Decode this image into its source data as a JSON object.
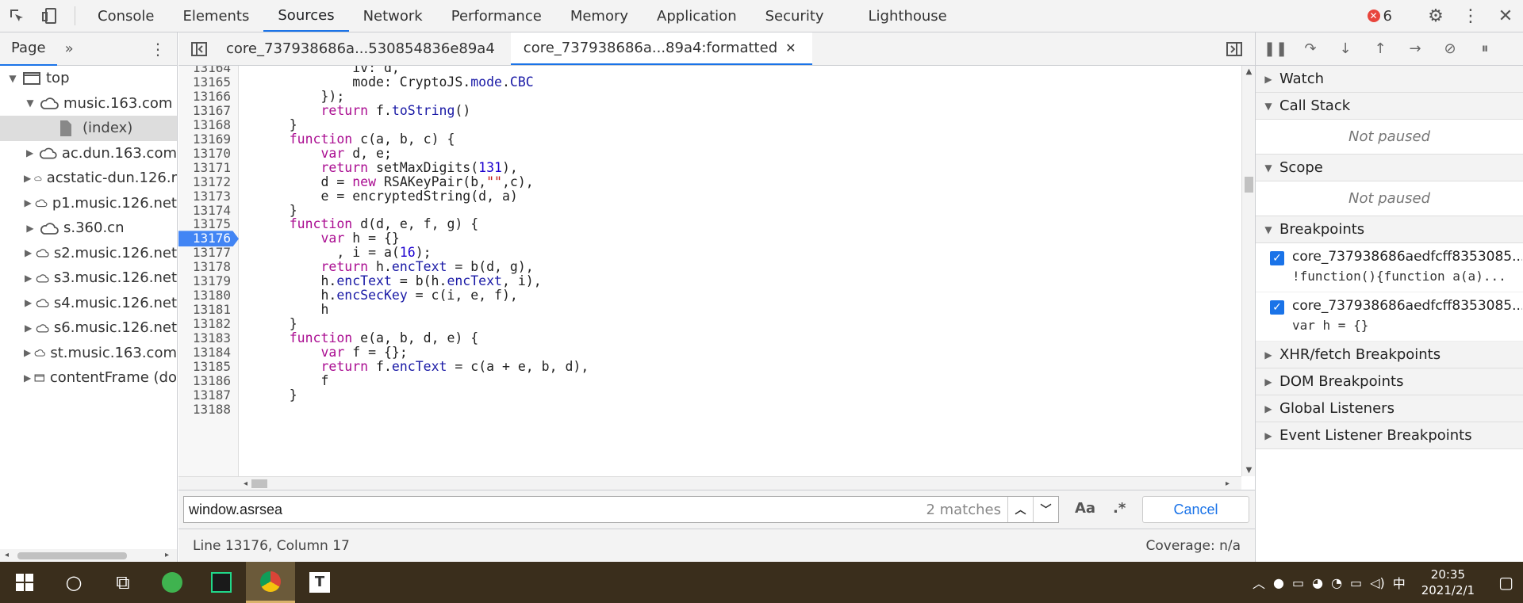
{
  "devtools_tabs": [
    "Console",
    "Elements",
    "Sources",
    "Network",
    "Performance",
    "Memory",
    "Application",
    "Security",
    "Lighthouse"
  ],
  "active_tab": "Sources",
  "error_count": "6",
  "navigator": {
    "tab_label": "Page",
    "tree": [
      {
        "label": "top",
        "type": "frame",
        "depth": 0,
        "expanded": true
      },
      {
        "label": "music.163.com",
        "type": "cloud",
        "depth": 1,
        "expanded": true
      },
      {
        "label": "(index)",
        "type": "file",
        "depth": 2,
        "selected": true
      },
      {
        "label": "ac.dun.163.com",
        "type": "cloud",
        "depth": 1
      },
      {
        "label": "acstatic-dun.126.r",
        "type": "cloud",
        "depth": 1
      },
      {
        "label": "p1.music.126.net",
        "type": "cloud",
        "depth": 1
      },
      {
        "label": "s.360.cn",
        "type": "cloud",
        "depth": 1
      },
      {
        "label": "s2.music.126.net",
        "type": "cloud",
        "depth": 1
      },
      {
        "label": "s3.music.126.net",
        "type": "cloud",
        "depth": 1
      },
      {
        "label": "s4.music.126.net",
        "type": "cloud",
        "depth": 1
      },
      {
        "label": "s6.music.126.net",
        "type": "cloud",
        "depth": 1
      },
      {
        "label": "st.music.163.com",
        "type": "cloud",
        "depth": 1
      },
      {
        "label": "contentFrame (do",
        "type": "frame",
        "depth": 1
      }
    ]
  },
  "editor": {
    "file_tabs": [
      {
        "label": "core_737938686a...530854836e89a4",
        "active": false
      },
      {
        "label": "core_737938686a...89a4:formatted",
        "active": true
      }
    ],
    "lines": [
      {
        "n": "13164",
        "code": "            iv: d,"
      },
      {
        "n": "13165",
        "code": "            mode: CryptoJS.mode.CBC"
      },
      {
        "n": "13166",
        "code": "        });"
      },
      {
        "n": "13167",
        "code": "        return f.toString()"
      },
      {
        "n": "13168",
        "code": "    }"
      },
      {
        "n": "13169",
        "code": "    function c(a, b, c) {"
      },
      {
        "n": "13170",
        "code": "        var d, e;"
      },
      {
        "n": "13171",
        "code": "        return setMaxDigits(131),"
      },
      {
        "n": "13172",
        "code": "        d = new RSAKeyPair(b,\"\",c),"
      },
      {
        "n": "13173",
        "code": "        e = encryptedString(d, a)"
      },
      {
        "n": "13174",
        "code": "    }"
      },
      {
        "n": "13175",
        "code": "    function d(d, e, f, g) {"
      },
      {
        "n": "13176",
        "code": "        var h = {}",
        "breakpoint": true
      },
      {
        "n": "13177",
        "code": "          , i = a(16);"
      },
      {
        "n": "13178",
        "code": "        return h.encText = b(d, g),"
      },
      {
        "n": "13179",
        "code": "        h.encText = b(h.encText, i),"
      },
      {
        "n": "13180",
        "code": "        h.encSecKey = c(i, e, f),"
      },
      {
        "n": "13181",
        "code": "        h"
      },
      {
        "n": "13182",
        "code": "    }"
      },
      {
        "n": "13183",
        "code": "    function e(a, b, d, e) {"
      },
      {
        "n": "13184",
        "code": "        var f = {};"
      },
      {
        "n": "13185",
        "code": "        return f.encText = c(a + e, b, d),"
      },
      {
        "n": "13186",
        "code": "        f"
      },
      {
        "n": "13187",
        "code": "    }"
      },
      {
        "n": "13188",
        "code": ""
      }
    ]
  },
  "search": {
    "query": "window.asrsea",
    "matches": "2 matches",
    "case_label": "Aa",
    "regex_label": ".*",
    "cancel_label": "Cancel"
  },
  "status": {
    "position": "Line 13176, Column 17",
    "coverage": "Coverage: n/a"
  },
  "debugger": {
    "panes": {
      "watch": "Watch",
      "call_stack": "Call Stack",
      "scope": "Scope",
      "breakpoints": "Breakpoints",
      "xhr": "XHR/fetch Breakpoints",
      "dom": "DOM Breakpoints",
      "global": "Global Listeners",
      "event": "Event Listener Breakpoints"
    },
    "not_paused": "Not paused",
    "breakpoints": [
      {
        "file": "core_737938686aedfcff8353085...",
        "code": "!function(){function a(a)..."
      },
      {
        "file": "core_737938686aedfcff8353085...",
        "code": "var h = {}"
      }
    ]
  },
  "taskbar": {
    "time": "20:35",
    "date": "2021/2/1",
    "ime": "中"
  },
  "colors": {
    "accent": "#1a73e8",
    "breakpoint": "#4285f4",
    "error": "#e8453c",
    "taskbar": "#3a2e1c"
  }
}
